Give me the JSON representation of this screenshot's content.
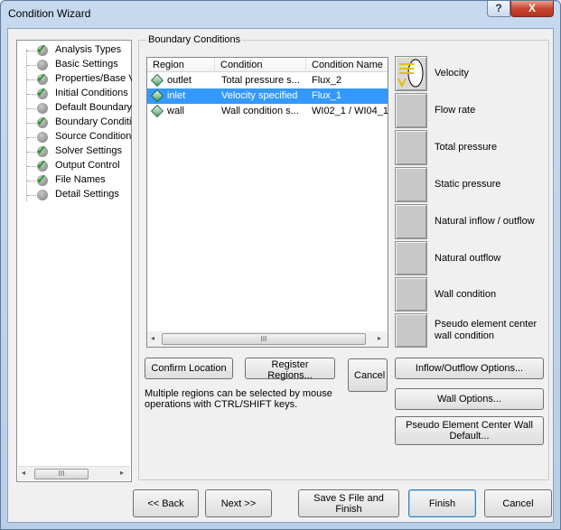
{
  "window": {
    "title": "Condition Wizard",
    "help_label": "?",
    "close_label": "X"
  },
  "tree": {
    "items": [
      {
        "label": "Analysis Types",
        "status": "done"
      },
      {
        "label": "Basic Settings",
        "status": "pending"
      },
      {
        "label": "Properties/Base V",
        "status": "done"
      },
      {
        "label": "Initial Conditions",
        "status": "done"
      },
      {
        "label": "Default Boundary",
        "status": "pending"
      },
      {
        "label": "Boundary Conditio",
        "status": "done"
      },
      {
        "label": "Source Conditions",
        "status": "pending"
      },
      {
        "label": "Solver Settings",
        "status": "done"
      },
      {
        "label": "Output Control",
        "status": "done"
      },
      {
        "label": "File Names",
        "status": "done"
      },
      {
        "label": "Detail Settings",
        "status": "pending"
      }
    ],
    "scroll_left": "◂",
    "scroll_right": "▸",
    "scroll_thumb": "III"
  },
  "boundary": {
    "group_label": "Boundary Conditions",
    "columns": [
      "Region",
      "Condition",
      "Condition Name"
    ],
    "rows": [
      {
        "region": "outlet",
        "condition": "Total pressure s...",
        "name": "Flux_2",
        "selected": false
      },
      {
        "region": "inlet",
        "condition": "Velocity specified",
        "name": "Flux_1",
        "selected": true
      },
      {
        "region": "wall",
        "condition": "Wall condition s...",
        "name": "WI02_1 / WI04_1",
        "selected": false
      }
    ],
    "scroll_left": "◂",
    "scroll_right": "▸",
    "scroll_thumb": "III",
    "confirm_label": "Confirm Location",
    "register_label": "Register Regions...",
    "cancel_label": "Cancel",
    "info_text": "Multiple regions can be selected by mouse operations with CTRL/SHIFT keys.",
    "condition_types": [
      {
        "label": "Velocity",
        "icon": "velocity-icon"
      },
      {
        "label": "Flow rate",
        "icon": ""
      },
      {
        "label": "Total pressure",
        "icon": ""
      },
      {
        "label": "Static pressure",
        "icon": ""
      },
      {
        "label": "Natural inflow / outflow",
        "icon": ""
      },
      {
        "label": "Natural outflow",
        "icon": ""
      },
      {
        "label": "Wall condition",
        "icon": ""
      },
      {
        "label": "Pseudo element center wall condition",
        "icon": ""
      }
    ],
    "inflow_options_label": "Inflow/Outflow Options...",
    "wall_options_label": "Wall Options...",
    "pseudo_default_label": "Pseudo Element Center Wall Default..."
  },
  "footer": {
    "back_label": "<< Back",
    "next_label": "Next >>",
    "save_label": "Save S File and Finish",
    "finish_label": "Finish",
    "cancel_label": "Cancel"
  },
  "colors": {
    "selection": "#3399ff",
    "check": "#1a9a1a",
    "diamond": "#4f9e6a"
  }
}
